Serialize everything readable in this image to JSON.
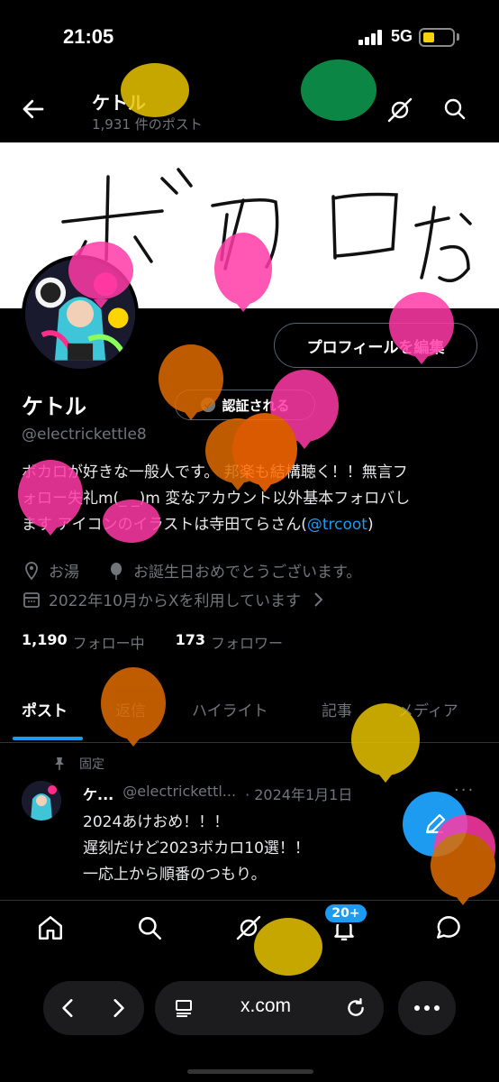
{
  "status_bar": {
    "time": "21:05",
    "network": "5G"
  },
  "header": {
    "name": "ケトル",
    "post_count": "1,931 件のポスト"
  },
  "profile": {
    "edit_button": "プロフィールを編集",
    "display_name": "ケトル",
    "verify_button": "認証される",
    "handle": "@electrickettle8",
    "bio_line1": "ボカロが好きな一般人です。 邦楽も結構聴く！！無言フ",
    "bio_line2": "ォロー失礼m(_ _)m 変なアカウント以外基本フォロバし",
    "bio_line3": "ます アイコンのイラストは寺田てらさん(",
    "bio_link": "@trcoot",
    "bio_line3_end": ")",
    "location": "お湯",
    "birthday": "お誕生日おめでとうございます。",
    "joined": "2022年10月からXを利用しています",
    "following_count": "1,190",
    "following_label": "フォロー中",
    "followers_count": "173",
    "followers_label": "フォロワー"
  },
  "banner_text": "ボカロお",
  "tabs": [
    {
      "label": "ポスト"
    },
    {
      "label": "返信"
    },
    {
      "label": "ハイライト"
    },
    {
      "label": "記事"
    },
    {
      "label": "メディア"
    }
  ],
  "pinned_post": {
    "pinned_label": "固定",
    "author": "ケ...",
    "handle": "@electrickettl...",
    "date": "· 2024年1月1日",
    "line1": "2024あけおめ！！！",
    "line2": "遅刻だけど2023ボカロ10選！！",
    "line3": "一応上から順番のつもり。"
  },
  "bottom_nav": {
    "items": [
      "home-icon",
      "search-icon",
      "grok-icon",
      "notifications-icon",
      "messages-icon"
    ],
    "notification_badge": "20+"
  },
  "browser": {
    "url": "x.com"
  },
  "colors": {
    "accent": "#1d9bf0",
    "background": "#000000",
    "muted": "#71767b"
  }
}
